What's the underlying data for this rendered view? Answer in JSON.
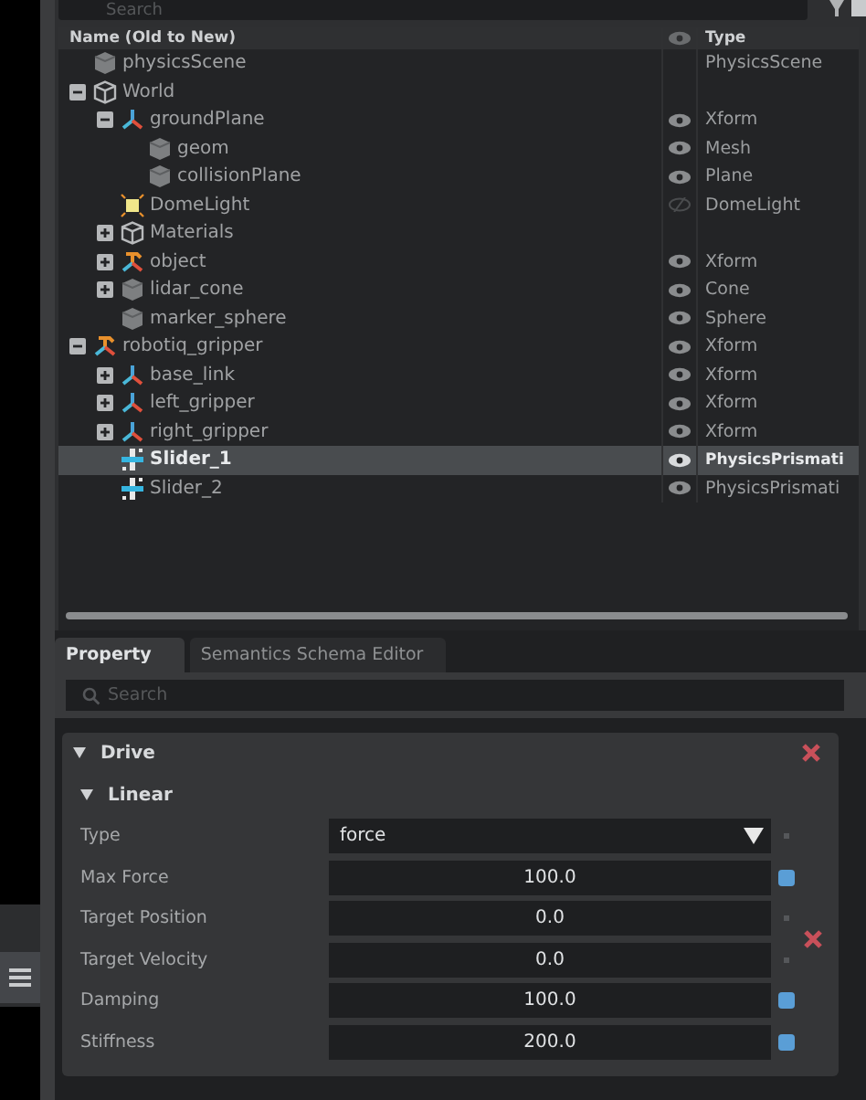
{
  "stage": {
    "search": {
      "placeholder": "Search"
    },
    "columns": [
      "Name (Old to New)",
      "Type"
    ],
    "tree": [
      {
        "name": "physicsScene",
        "kind": "mesh",
        "type": "PhysicsScene",
        "selected": false
      },
      {
        "name": "World",
        "kind": "world",
        "expanded": true,
        "selected": false,
        "children": [
          {
            "name": "groundPlane",
            "kind": "xform",
            "type": "Xform",
            "visible": true,
            "expanded": true,
            "selected": false,
            "children": [
              {
                "name": "geom",
                "kind": "mesh",
                "type": "Mesh",
                "visible": true,
                "selected": false
              },
              {
                "name": "collisionPlane",
                "kind": "mesh",
                "type": "Plane",
                "visible": true,
                "selected": false
              }
            ]
          },
          {
            "name": "DomeLight",
            "kind": "light",
            "type": "DomeLight",
            "visible": false,
            "selected": false
          },
          {
            "name": "Materials",
            "kind": "world",
            "expanded": false,
            "selected": false
          },
          {
            "name": "object",
            "kind": "object",
            "type": "Xform",
            "visible": true,
            "expanded": false,
            "selected": false
          },
          {
            "name": "lidar_cone",
            "kind": "mesh",
            "type": "Cone",
            "visible": true,
            "expanded": false,
            "selected": false
          },
          {
            "name": "marker_sphere",
            "kind": "mesh",
            "type": "Sphere",
            "visible": true,
            "selected": false
          }
        ]
      },
      {
        "name": "robotiq_gripper",
        "kind": "object",
        "type": "Xform",
        "visible": true,
        "expanded": true,
        "selected": false,
        "children": [
          {
            "name": "base_link",
            "kind": "xform",
            "type": "Xform",
            "visible": true,
            "expanded": false,
            "selected": false
          },
          {
            "name": "left_gripper",
            "kind": "xform",
            "type": "Xform",
            "visible": true,
            "expanded": false,
            "selected": false
          },
          {
            "name": "right_gripper",
            "kind": "xform",
            "type": "Xform",
            "visible": true,
            "expanded": false,
            "selected": false
          },
          {
            "name": "Slider_1",
            "kind": "joint",
            "type": "PhysicsPrismati",
            "visible": true,
            "selected": true
          },
          {
            "name": "Slider_2",
            "kind": "joint",
            "type": "PhysicsPrismati",
            "visible": true,
            "selected": false
          }
        ]
      }
    ]
  },
  "property": {
    "tabs": [
      {
        "label": "Property",
        "selected": true
      },
      {
        "label": "Semantics Schema Editor",
        "selected": false
      }
    ],
    "search": {
      "placeholder": "Search"
    },
    "section": {
      "title": "Drive",
      "expanded": true,
      "group": {
        "title": "Linear",
        "expanded": true,
        "rows": [
          {
            "label": "Type",
            "kind": "dropdown",
            "value": "force",
            "changed": false
          },
          {
            "label": "Max Force",
            "kind": "number",
            "value": "100.0",
            "changed": true
          },
          {
            "label": "Target Position",
            "kind": "number",
            "value": "0.0",
            "changed": false
          },
          {
            "label": "Target Velocity",
            "kind": "number",
            "value": "0.0",
            "changed": false
          },
          {
            "label": "Damping",
            "kind": "number",
            "value": "100.0",
            "changed": true
          },
          {
            "label": "Stiffness",
            "kind": "number",
            "value": "200.0",
            "changed": true
          }
        ]
      }
    }
  }
}
